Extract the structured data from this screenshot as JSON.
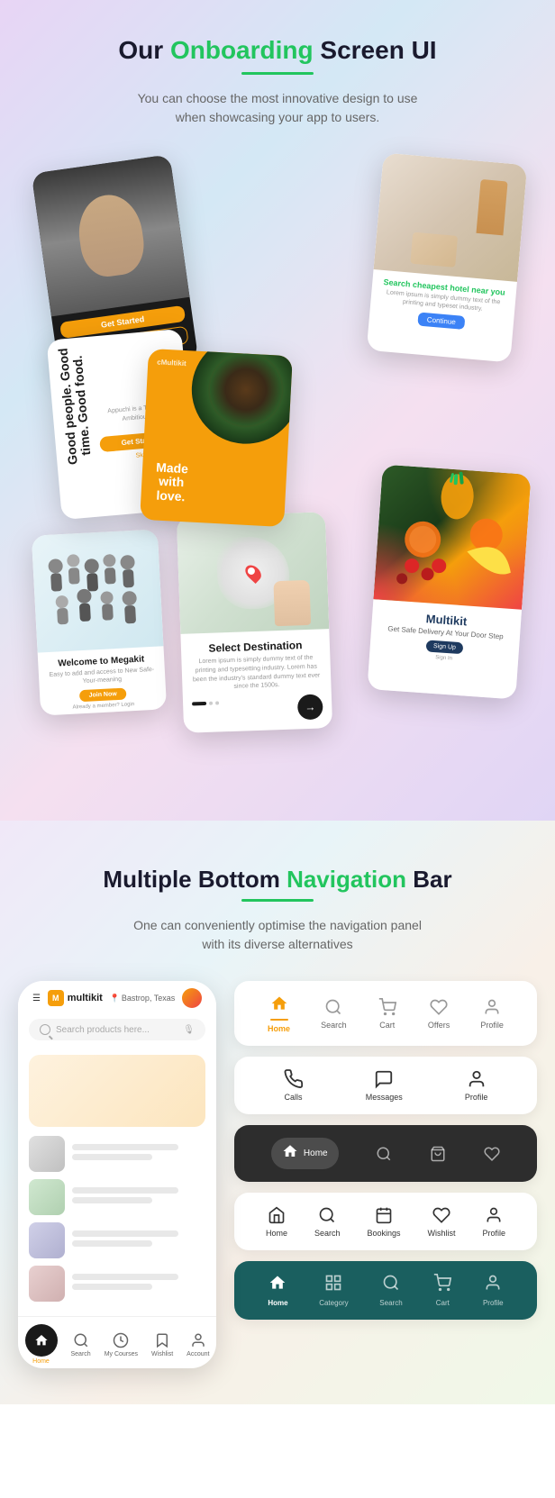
{
  "onboarding": {
    "title_before": "Our ",
    "title_highlight": "Onboarding",
    "title_after": " Screen UI",
    "subtitle_line1": "You can choose the most innovative design to use",
    "subtitle_line2": "when showcasing your app to users.",
    "cards": {
      "dark_portrait": {
        "get_started": "Get Started",
        "login": "Login"
      },
      "room": {
        "tag": "Search cheapest hotel near you",
        "lorem": "Lorem ipsum is simply dummy text of the printing and typeset industry.",
        "continue": "Continue"
      },
      "food_text": {
        "line1": "Good people. Good",
        "line2": "time.",
        "line3": "Good food.",
        "desc": "Appuchi is a THL 10X Ambitious...",
        "get_started": "Get Started",
        "skip": "Skip"
      },
      "orange": {
        "brand": "cMultikit",
        "title": "Made with love."
      },
      "welcome": {
        "heading": "Welcome to Megakit",
        "desc": "Easy to add and access to New Safe-Your-meaning",
        "join": "Join Now",
        "already": "Already a member? Login"
      },
      "destination": {
        "heading": "Select Destination",
        "lorem": "Lorem ipsum is simply dummy text of the printing and typesetting industry. Lorem has been the industry's standard dummy text ever since the 1500s."
      },
      "fruits": {
        "brand": "Multikit",
        "tagline": "Get Safe Delivery At Your Door Step",
        "sign_in": "Sign In",
        "signup": "Sign Up"
      }
    }
  },
  "bottom_nav": {
    "title_before": "Multiple Bottom ",
    "title_highlight": "Navigation",
    "title_after": " Bar",
    "subtitle_line1": "One can conveniently optimise the navigation panel",
    "subtitle_line2": "with its diverse alternatives",
    "phone": {
      "location": "Bastrop, Texas",
      "logo": "multikit",
      "search_placeholder": "Search products here...",
      "nav_items": [
        {
          "label": "Home",
          "active": true
        },
        {
          "label": "Search"
        },
        {
          "label": "My Courses"
        },
        {
          "label": "Wishlist"
        },
        {
          "label": "Account"
        }
      ]
    },
    "nav_bar_1": {
      "items": [
        {
          "label": "Home",
          "active": true
        },
        {
          "label": "Search"
        },
        {
          "label": "Cart"
        },
        {
          "label": "Offers"
        },
        {
          "label": "Profile"
        }
      ]
    },
    "nav_bar_2": {
      "items": [
        {
          "label": "Calls"
        },
        {
          "label": "Messages"
        },
        {
          "label": "Profile"
        }
      ]
    },
    "nav_bar_3": {
      "items": [
        {
          "label": "Home",
          "active": true
        },
        {
          "label": ""
        },
        {
          "label": ""
        },
        {
          "label": ""
        }
      ]
    },
    "nav_bar_4": {
      "items": [
        {
          "label": "Home"
        },
        {
          "label": "Search"
        },
        {
          "label": "Bookings"
        },
        {
          "label": "Wishlist"
        },
        {
          "label": "Profile"
        }
      ]
    },
    "nav_bar_5": {
      "items": [
        {
          "label": "Home",
          "active": true
        },
        {
          "label": "Category"
        },
        {
          "label": "Search"
        },
        {
          "label": "Cart"
        },
        {
          "label": "Profile"
        }
      ]
    }
  }
}
